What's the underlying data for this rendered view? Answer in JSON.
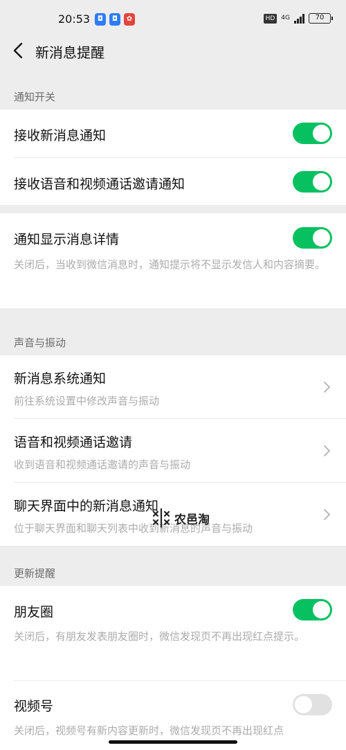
{
  "status_bar": {
    "time": "20:53",
    "app_badges": [
      "app-blue-icon",
      "app-blue-icon",
      "app-red-icon"
    ],
    "hd": "HD",
    "network": "4G",
    "battery": "70"
  },
  "nav": {
    "back_icon": "chevron-left-icon",
    "title": "新消息提醒"
  },
  "sections": {
    "notify_switch": "通知开关",
    "sound_vibration": "声音与振动",
    "update_reminder": "更新提醒"
  },
  "rows": {
    "receive_new": {
      "title": "接收新消息通知",
      "on": true
    },
    "receive_call": {
      "title": "接收语音和视频通话邀请通知",
      "on": true
    },
    "show_detail": {
      "title": "通知显示消息详情",
      "subtitle": "关闭后，当收到微信消息时，通知提示将不显示发信人和内容摘要。",
      "on": true
    },
    "system_notify": {
      "title": "新消息系统通知",
      "subtitle": "前往系统设置中修改声音与振动"
    },
    "call_invite": {
      "title": "语音和视频通话邀请",
      "subtitle": "收到语音和视频通话邀请的声音与振动"
    },
    "chat_notify": {
      "title": "聊天界面中的新消息通知",
      "subtitle": "位于聊天界面和聊天列表中收到新消息的声音与振动"
    },
    "moments": {
      "title": "朋友圈",
      "subtitle": "关闭后，有朋友发表朋友圈时，微信发现页不再出现红点提示。",
      "on": true
    },
    "channels": {
      "title": "视频号",
      "subtitle": "关闭后，视频号有新内容更新时，微信发现页不再出现红点",
      "on": false
    }
  },
  "watermark": {
    "text": "农邑淘"
  },
  "colors": {
    "accent": "#07c160",
    "background": "#ededed",
    "toggle_off": "#e1e1e1"
  }
}
